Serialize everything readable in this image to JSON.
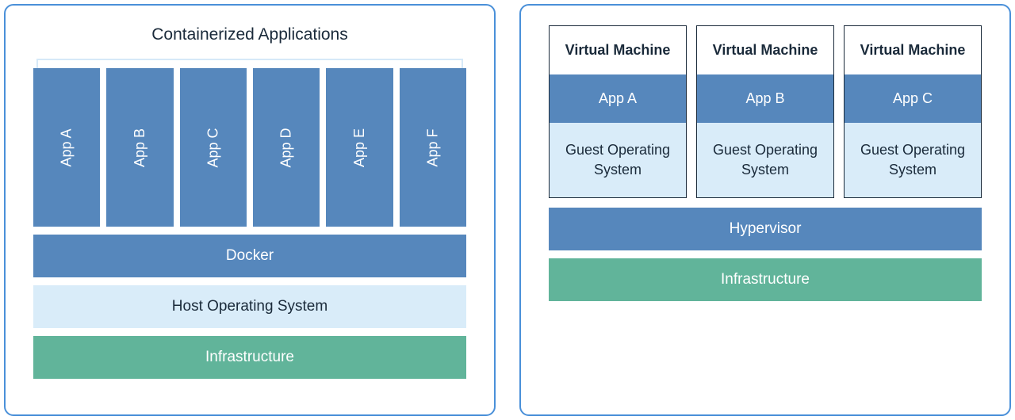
{
  "left": {
    "title": "Containerized Applications",
    "apps": [
      "App A",
      "App B",
      "App C",
      "App D",
      "App E",
      "App F"
    ],
    "docker": "Docker",
    "host_os": "Host Operating System",
    "infra": "Infrastructure"
  },
  "right": {
    "vms": [
      {
        "title": "Virtual Machine",
        "app": "App A",
        "guest": "Guest Operating System"
      },
      {
        "title": "Virtual Machine",
        "app": "App B",
        "guest": "Guest Operating System"
      },
      {
        "title": "Virtual Machine",
        "app": "App C",
        "guest": "Guest Operating System"
      }
    ],
    "hypervisor": "Hypervisor",
    "infra": "Infrastructure"
  }
}
